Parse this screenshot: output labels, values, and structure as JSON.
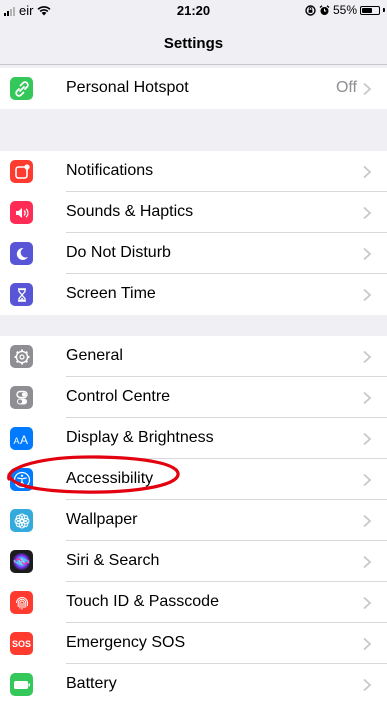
{
  "status_bar": {
    "carrier": "eir",
    "time": "21:20",
    "battery_percent": "55%",
    "battery_level": 0.55
  },
  "nav": {
    "title": "Settings"
  },
  "groups": [
    {
      "items": [
        {
          "label": "Personal Hotspot",
          "value": "Off",
          "icon": "personal-hotspot-icon",
          "color": "#34c759"
        }
      ]
    },
    {
      "items": [
        {
          "label": "Notifications",
          "icon": "notifications-icon",
          "color": "#ff3b30"
        },
        {
          "label": "Sounds & Haptics",
          "icon": "speaker-icon",
          "color": "#ff2d55"
        },
        {
          "label": "Do Not Disturb",
          "icon": "moon-icon",
          "color": "#5856d6"
        },
        {
          "label": "Screen Time",
          "icon": "hourglass-icon",
          "color": "#5856d6"
        }
      ]
    },
    {
      "items": [
        {
          "label": "General",
          "icon": "gear-icon",
          "color": "#8e8e93"
        },
        {
          "label": "Control Centre",
          "icon": "toggles-icon",
          "color": "#8e8e93"
        },
        {
          "label": "Display & Brightness",
          "icon": "text-size-icon",
          "color": "#007aff"
        },
        {
          "label": "Accessibility",
          "icon": "accessibility-icon",
          "color": "#007aff",
          "highlighted": true
        },
        {
          "label": "Wallpaper",
          "icon": "flower-icon",
          "color": "#34aadc"
        },
        {
          "label": "Siri & Search",
          "icon": "siri-icon",
          "color": "#1c1c1e"
        },
        {
          "label": "Touch ID & Passcode",
          "icon": "fingerprint-icon",
          "color": "#ff3b30"
        },
        {
          "label": "Emergency SOS",
          "icon": "sos-icon",
          "color": "#ff3b30",
          "icon_text": "SOS"
        },
        {
          "label": "Battery",
          "icon": "battery-icon",
          "color": "#34c759"
        }
      ]
    }
  ],
  "annotation": {
    "color": "#e3000f"
  },
  "colors": {
    "background": "#efeff4",
    "separator": "#d9d9dd",
    "chevron": "#c7c7cc",
    "secondary_text": "#8e8e93"
  }
}
